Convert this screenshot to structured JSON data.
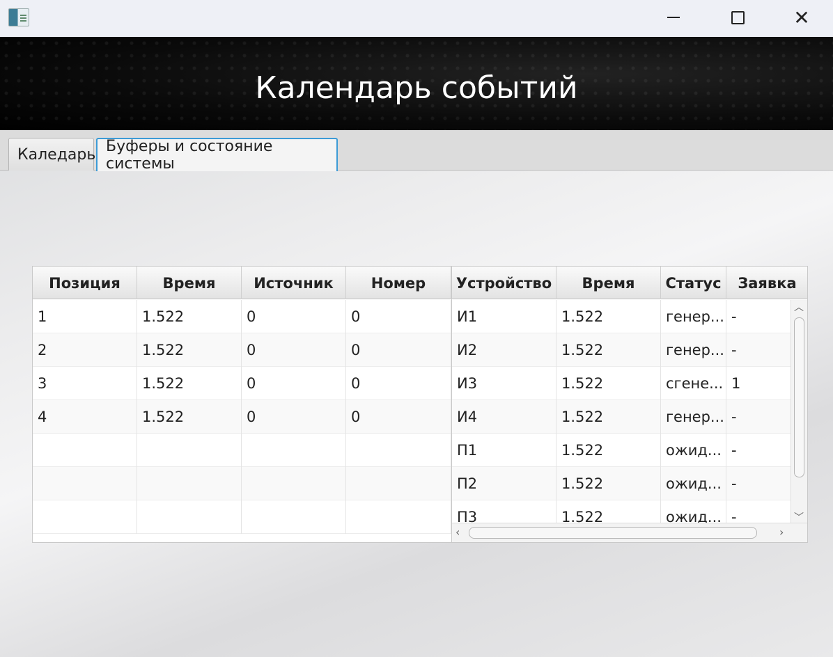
{
  "window": {
    "app_icon": "app-window-icon",
    "minimize_icon": "minimize-icon",
    "maximize_icon": "maximize-icon",
    "close_icon": "close-icon",
    "close_glyph": "✕"
  },
  "header": {
    "title": "Календарь событий"
  },
  "tabs": [
    {
      "label": "Каледарь",
      "selected": false
    },
    {
      "label": "Буферы и состояние системы",
      "selected": true
    }
  ],
  "buffer_table": {
    "columns": [
      "Позиция",
      "Время",
      "Источник",
      "Номер"
    ],
    "rows": [
      [
        "1",
        "1.522",
        "0",
        "0"
      ],
      [
        "2",
        "1.522",
        "0",
        "0"
      ],
      [
        "3",
        "1.522",
        "0",
        "0"
      ],
      [
        "4",
        "1.522",
        "0",
        "0"
      ],
      [
        "",
        "",
        "",
        ""
      ],
      [
        "",
        "",
        "",
        ""
      ],
      [
        "",
        "",
        "",
        ""
      ]
    ]
  },
  "device_table": {
    "columns": [
      "Устройство",
      "Время",
      "Статус",
      "Заявка"
    ],
    "rows": [
      [
        "И1",
        "1.522",
        "генер...",
        "-"
      ],
      [
        "И2",
        "1.522",
        "генер...",
        "-"
      ],
      [
        "И3",
        "1.522",
        "сгене...",
        "1"
      ],
      [
        "И4",
        "1.522",
        "генер...",
        "-"
      ],
      [
        "П1",
        "1.522",
        "ожид...",
        "-"
      ],
      [
        "П2",
        "1.522",
        "ожид...",
        "-"
      ],
      [
        "П3",
        "1.522",
        "ожид...",
        "-"
      ]
    ],
    "scroll_up_glyph": "︿",
    "scroll_down_glyph": "﹀",
    "scroll_left_glyph": "‹",
    "scroll_right_glyph": "›"
  }
}
